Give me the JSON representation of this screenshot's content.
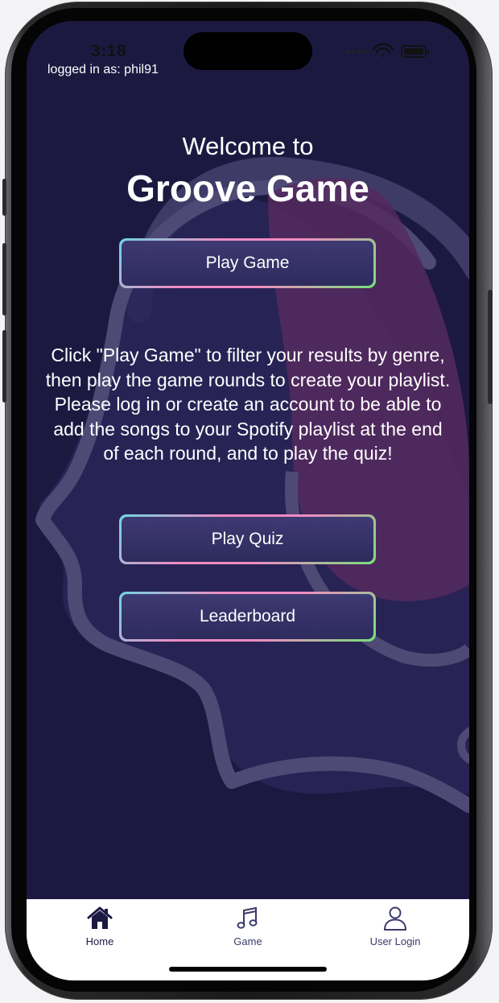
{
  "status_bar": {
    "time": "3:18"
  },
  "session": {
    "logged_in_text": "logged in as: phil91"
  },
  "hero": {
    "welcome": "Welcome to",
    "title": "Groove Game"
  },
  "buttons": {
    "play_game": "Play Game",
    "play_quiz": "Play Quiz",
    "leaderboard": "Leaderboard"
  },
  "instructions": "Click \"Play Game\" to filter your results by genre, then play the game rounds to create your playlist. Please log in or create an account to be able to add the songs to your Spotify playlist at the end of each round, and to play the quiz!",
  "tabs": [
    {
      "label": "Home",
      "icon": "home-icon",
      "active": true
    },
    {
      "label": "Game",
      "icon": "music-note-icon",
      "active": false
    },
    {
      "label": "User Login",
      "icon": "user-icon",
      "active": false
    }
  ],
  "colors": {
    "background": "#1c1941",
    "button_fill": "#3e3a72",
    "border_pink": "#f28bc3",
    "border_cyan": "#6fd6e3",
    "border_green": "#77e07a",
    "tab_active": "#1c1941",
    "tab_inactive": "#3b3a6b"
  }
}
